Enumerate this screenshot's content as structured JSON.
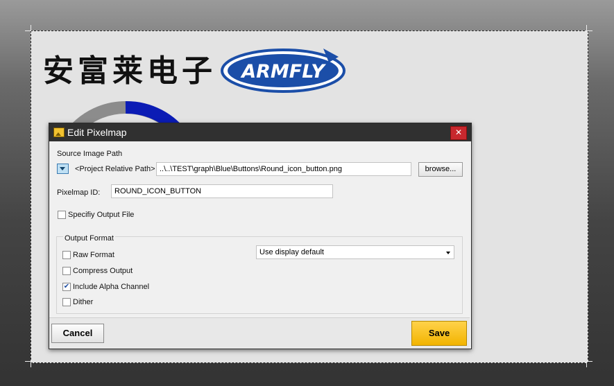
{
  "workspace": {
    "chinese_title": "安富莱电子",
    "logo_text": "ARMFLY"
  },
  "dialog": {
    "title": "Edit Pixelmap",
    "close_glyph": "✕",
    "source_image_path_label": "Source Image Path",
    "path_mode": "<Project Relative Path>",
    "path_value": "..\\..\\TEST\\graph\\Blue\\Buttons\\Round_icon_button.png",
    "browse_label": "browse...",
    "pixelmap_id_label": "Pixelmap ID:",
    "pixelmap_id_value": "ROUND_ICON_BUTTON",
    "specify_output_label": "Specifiy Output File",
    "specify_output_checked": false,
    "output_format": {
      "group_label": "Output Format",
      "raw_format_label": "Raw Format",
      "raw_format_checked": false,
      "compress_output_label": "Compress Output",
      "compress_output_checked": false,
      "include_alpha_label": "Include Alpha Channel",
      "include_alpha_checked": true,
      "dither_label": "Dither",
      "dither_checked": false,
      "display_select_value": "Use display default"
    },
    "cancel_label": "Cancel",
    "save_label": "Save"
  },
  "colors": {
    "ring_blue": "#0b1cb5",
    "ring_gray": "#8c8c8c",
    "logo_blue": "#1b4ea8",
    "highlight": "#e8322f",
    "save_yellow": "#f6c21a"
  }
}
